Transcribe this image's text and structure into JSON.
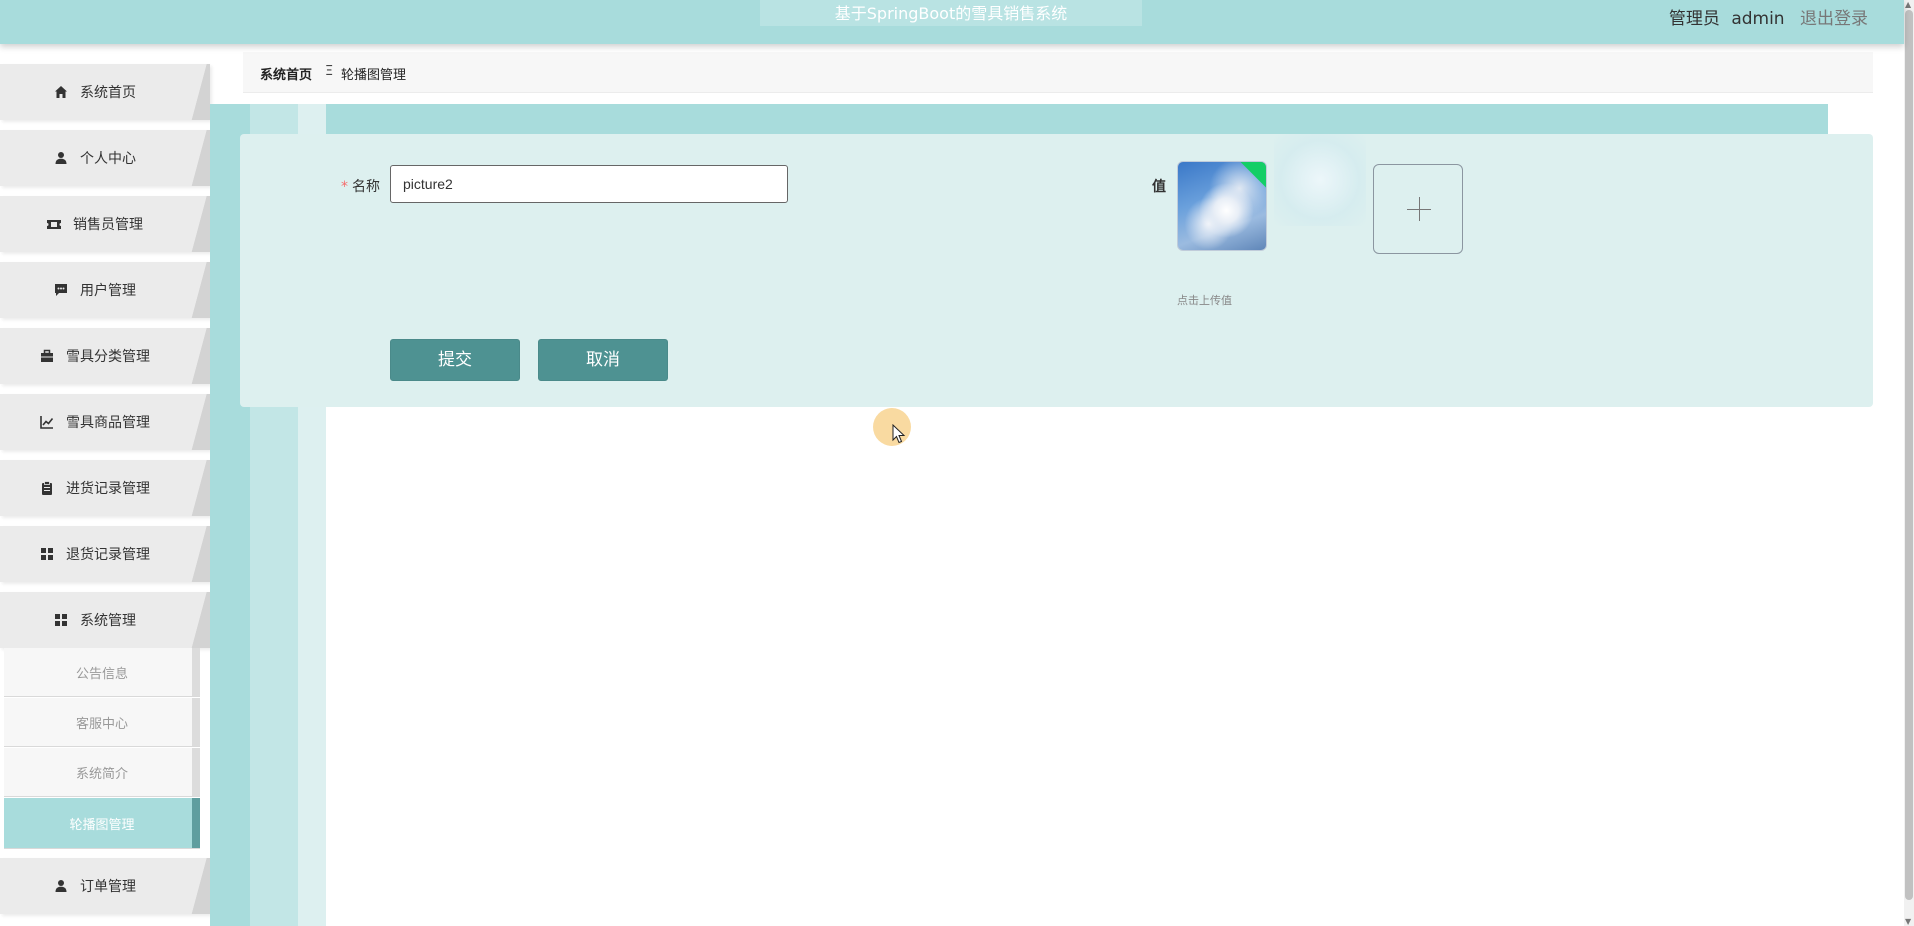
{
  "header": {
    "app_title": "基于SpringBoot的雪具销售系统",
    "user_role": "管理员",
    "user_name": "admin",
    "logout_label": "退出登录"
  },
  "sidebar": {
    "items": [
      {
        "label": "系统首页",
        "icon": "home-icon"
      },
      {
        "label": "个人中心",
        "icon": "user-icon"
      },
      {
        "label": "销售员管理",
        "icon": "ticket-icon"
      },
      {
        "label": "用户管理",
        "icon": "chat-icon"
      },
      {
        "label": "雪具分类管理",
        "icon": "briefcase-icon"
      },
      {
        "label": "雪具商品管理",
        "icon": "chart-icon"
      },
      {
        "label": "进货记录管理",
        "icon": "clipboard-icon"
      },
      {
        "label": "退货记录管理",
        "icon": "grid-icon"
      },
      {
        "label": "系统管理",
        "icon": "grid-icon"
      },
      {
        "label": "订单管理",
        "icon": "user-icon"
      }
    ],
    "submenu": [
      {
        "label": "公告信息"
      },
      {
        "label": "客服中心"
      },
      {
        "label": "系统简介"
      },
      {
        "label": "轮播图管理",
        "active": true
      }
    ]
  },
  "breadcrumb": {
    "home": "系统首页",
    "separator": "Ξ",
    "current": "轮播图管理"
  },
  "form": {
    "name_label": "名称",
    "required_mark": "*",
    "name_value": "picture2",
    "value_label": "值",
    "upload_tip": "点击上传值",
    "submit_label": "提交",
    "cancel_label": "取消"
  },
  "colors": {
    "header_bg": "#a8dcdc",
    "card_bg": "#ddf0ef",
    "button_bg": "#4e9292",
    "upload_success": "#13ce66",
    "required": "#f56c6c"
  }
}
